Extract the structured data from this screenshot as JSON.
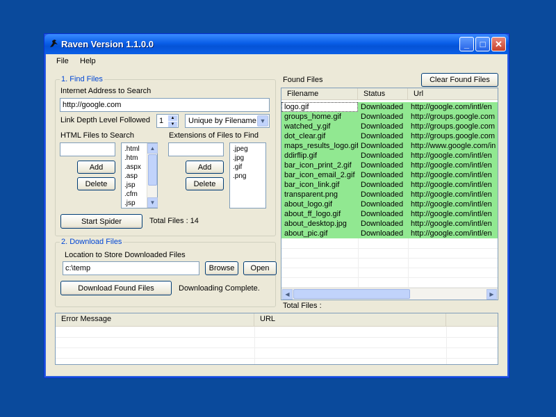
{
  "window": {
    "title": "Raven Version 1.1.0.0",
    "minimize": "_",
    "maximize": "□",
    "close": "✕"
  },
  "menu": [
    "File",
    "Help"
  ],
  "find_files": {
    "legend": "1. Find Files",
    "address_label": "Internet Address to Search",
    "address_value": "http://google.com",
    "depth_label": "Link Depth Level Followed",
    "depth_value": "1",
    "filter_value": "Unique by Filename",
    "html_label": "HTML Files to Search",
    "html_items": [
      ".html",
      ".htm",
      ".aspx",
      ".asp",
      ".jsp",
      ".cfm",
      ".jsp"
    ],
    "ext_label": "Extensions of Files to Find",
    "ext_items": [
      ".jpeg",
      ".jpg",
      ".gif",
      ".png"
    ],
    "add_label": "Add",
    "delete_label": "Delete",
    "start_label": "Start Spider",
    "total_text": "Total Files : 14"
  },
  "download": {
    "legend": "2. Download Files",
    "location_label": "Location to Store Downloaded Files",
    "location_value": "c:\\temp",
    "browse_label": "Browse",
    "open_label": "Open",
    "download_label": "Download Found Files",
    "status_text": "Downloading Complete."
  },
  "found": {
    "label": "Found Files",
    "clear_label": "Clear Found Files",
    "columns": [
      "Filename",
      "Status",
      "Url"
    ],
    "rows": [
      [
        "logo.gif",
        "Downloaded",
        "http://google.com/intl/en"
      ],
      [
        "groups_home.gif",
        "Downloaded",
        "http://groups.google.com"
      ],
      [
        "watched_y.gif",
        "Downloaded",
        "http://groups.google.com"
      ],
      [
        "dot_clear.gif",
        "Downloaded",
        "http://groups.google.com"
      ],
      [
        "maps_results_logo.gif",
        "Downloaded",
        "http://www.google.com/in"
      ],
      [
        "ddirflip.gif",
        "Downloaded",
        "http://google.com/intl/en"
      ],
      [
        "bar_icon_print_2.gif",
        "Downloaded",
        "http://google.com/intl/en"
      ],
      [
        "bar_icon_email_2.gif",
        "Downloaded",
        "http://google.com/intl/en"
      ],
      [
        "bar_icon_link.gif",
        "Downloaded",
        "http://google.com/intl/en"
      ],
      [
        "transparent.png",
        "Downloaded",
        "http://google.com/intl/en"
      ],
      [
        "about_logo.gif",
        "Downloaded",
        "http://google.com/intl/en"
      ],
      [
        "about_ff_logo.gif",
        "Downloaded",
        "http://google.com/intl/en"
      ],
      [
        "about_desktop.jpg",
        "Downloaded",
        "http://google.com/intl/en"
      ],
      [
        "about_pic.gif",
        "Downloaded",
        "http://google.com/intl/en"
      ]
    ],
    "total_text": "Total Files :",
    "row_color": "#91e891"
  },
  "errors": {
    "columns": [
      "Error Message",
      "URL"
    ]
  }
}
